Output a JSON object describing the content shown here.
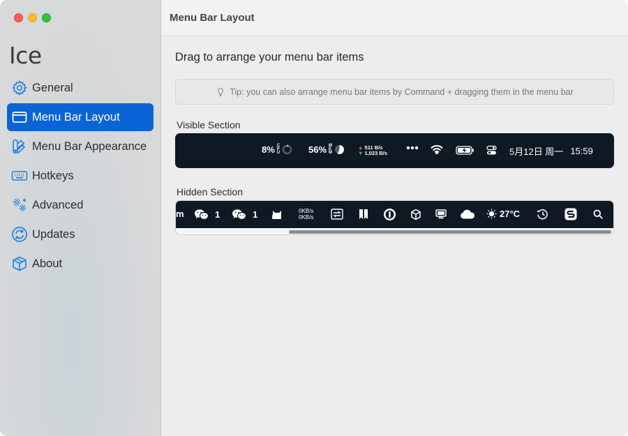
{
  "app": {
    "title": "Ice"
  },
  "sidebar": {
    "items": [
      {
        "label": "General",
        "icon": "gear-icon"
      },
      {
        "label": "Menu Bar Layout",
        "icon": "menubar-icon",
        "active": true
      },
      {
        "label": "Menu Bar Appearance",
        "icon": "appearance-icon"
      },
      {
        "label": "Hotkeys",
        "icon": "keyboard-icon"
      },
      {
        "label": "Advanced",
        "icon": "gears-icon"
      },
      {
        "label": "Updates",
        "icon": "updates-icon"
      },
      {
        "label": "About",
        "icon": "cube-icon"
      }
    ]
  },
  "main": {
    "window_title": "Menu Bar Layout",
    "heading": "Drag to arrange your menu bar items",
    "tip": "Tip: you can also arrange menu bar items by Command + dragging them in the menu bar",
    "visible_section": {
      "label": "Visible Section",
      "cpu": "8%",
      "memory": "56%",
      "net_up": "511 B/s",
      "net_down": "1,023 B/s",
      "date": "5月12日 周一",
      "time": "15:59"
    },
    "hidden_section": {
      "label": "Hidden Section",
      "truncated_text": "m",
      "wechat1_count": "1",
      "wechat2_count": "1",
      "net_up": "0KB/s",
      "net_down": "0KB/s",
      "temperature": "27°C"
    }
  },
  "colors": {
    "accent": "#0a64d6",
    "menubar_bg": "#0f1924"
  }
}
